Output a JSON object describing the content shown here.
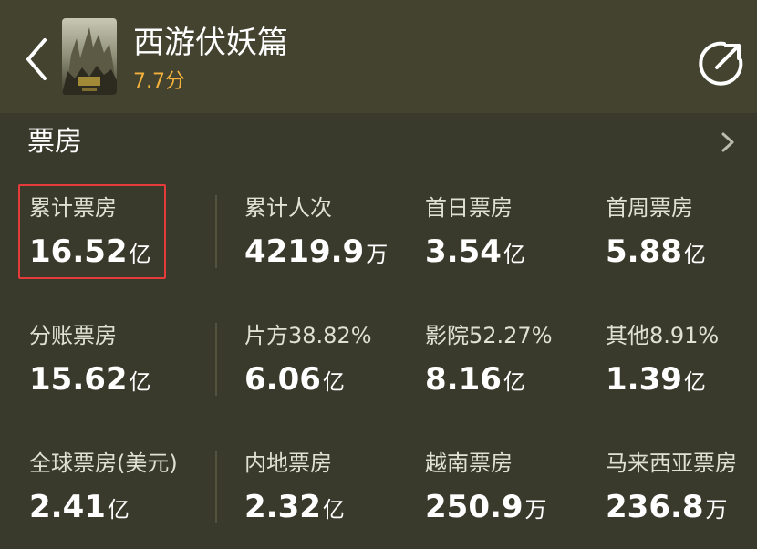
{
  "header": {
    "title": "西游伏妖篇",
    "score": "7.7分"
  },
  "section": {
    "title": "票房"
  },
  "stats": [
    {
      "label": "累计票房",
      "num": "16.52",
      "unit": "亿"
    },
    {
      "label": "累计人次",
      "num": "4219.9",
      "unit": "万"
    },
    {
      "label": "首日票房",
      "num": "3.54",
      "unit": "亿"
    },
    {
      "label": "首周票房",
      "num": "5.88",
      "unit": "亿"
    },
    {
      "label": "分账票房",
      "num": "15.62",
      "unit": "亿"
    },
    {
      "label": "片方38.82%",
      "num": "6.06",
      "unit": "亿"
    },
    {
      "label": "影院52.27%",
      "num": "8.16",
      "unit": "亿"
    },
    {
      "label": "其他8.91%",
      "num": "1.39",
      "unit": "亿"
    },
    {
      "label": "全球票房(美元)",
      "num": "2.41",
      "unit": "亿"
    },
    {
      "label": "内地票房",
      "num": "2.32",
      "unit": "亿"
    },
    {
      "label": "越南票房",
      "num": "250.9",
      "unit": "万"
    },
    {
      "label": "马来西亚票房",
      "num": "236.8",
      "unit": "万"
    }
  ],
  "colors": {
    "background": "#3a3a2c",
    "header": "#43432f",
    "score": "#f3b13c",
    "highlight": "#e63b3b"
  },
  "icons": {
    "back": "chevron-left-icon",
    "share": "share-icon",
    "more": "chevron-right-icon"
  }
}
